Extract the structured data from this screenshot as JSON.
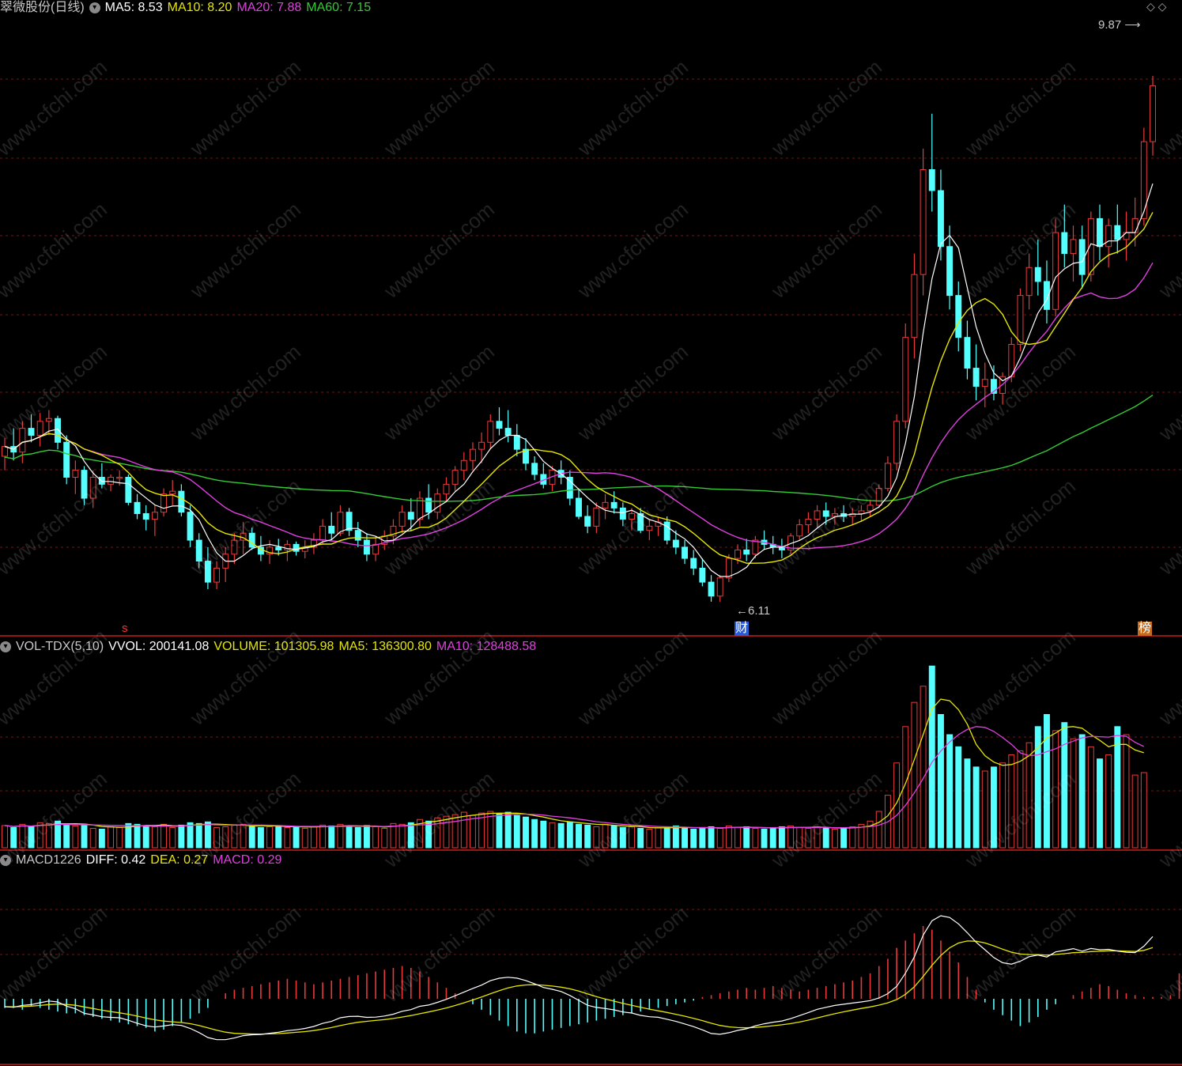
{
  "header_main": {
    "stock": "翠微股份(日线)",
    "ma5": "MA5: 8.53",
    "ma10": "MA10: 8.20",
    "ma20": "MA20: 7.88",
    "ma60": "MA60: 7.15"
  },
  "header_vol": {
    "name": "VOL-TDX(5,10)",
    "vvol": "VVOL: 200141.08",
    "volume": "VOLUME: 101305.98",
    "ma5": "MA5: 136300.80",
    "ma10": "MA10: 128488.58"
  },
  "header_macd": {
    "name": "MACD1226",
    "diff": "DIFF: 0.42",
    "dea": "DEA: 0.27",
    "macd": "MACD: 0.29"
  },
  "annotations": {
    "high": "9.87",
    "low": "6.11",
    "tag_s": "s",
    "tag_cai": "财",
    "tag_bang": "榜"
  },
  "watermark": "www.cfchi.com",
  "colors": {
    "up": "#e83a3a",
    "down": "#54ffff",
    "ma5": "#ffffff",
    "ma10": "#e6e600",
    "ma20": "#e040e0",
    "ma60": "#33cc33",
    "grid": "#7a1414",
    "divider": "#c81e1e"
  },
  "chart_data": {
    "type": "candlestick",
    "price_range": [
      5.9,
      10.3
    ],
    "ohlc": [
      [
        7.15,
        7.28,
        7.05,
        7.22
      ],
      [
        7.22,
        7.35,
        7.12,
        7.18
      ],
      [
        7.18,
        7.4,
        7.1,
        7.35
      ],
      [
        7.35,
        7.45,
        7.25,
        7.3
      ],
      [
        7.3,
        7.46,
        7.22,
        7.4
      ],
      [
        7.4,
        7.48,
        7.3,
        7.42
      ],
      [
        7.42,
        7.44,
        7.2,
        7.25
      ],
      [
        7.25,
        7.3,
        6.95,
        7.0
      ],
      [
        7.0,
        7.12,
        6.88,
        7.05
      ],
      [
        7.05,
        7.08,
        6.8,
        6.85
      ],
      [
        6.85,
        7.05,
        6.78,
        7.0
      ],
      [
        7.0,
        7.1,
        6.92,
        6.95
      ],
      [
        6.95,
        7.02,
        6.9,
        7.0
      ],
      [
        7.0,
        7.05,
        6.94,
        7.0
      ],
      [
        7.0,
        7.02,
        6.8,
        6.82
      ],
      [
        6.82,
        6.88,
        6.7,
        6.74
      ],
      [
        6.74,
        6.8,
        6.62,
        6.7
      ],
      [
        6.7,
        6.8,
        6.58,
        6.75
      ],
      [
        6.75,
        6.92,
        6.72,
        6.88
      ],
      [
        6.88,
        6.98,
        6.8,
        6.9
      ],
      [
        6.9,
        6.95,
        6.72,
        6.75
      ],
      [
        6.75,
        6.8,
        6.5,
        6.55
      ],
      [
        6.55,
        6.6,
        6.35,
        6.4
      ],
      [
        6.4,
        6.5,
        6.2,
        6.25
      ],
      [
        6.25,
        6.4,
        6.2,
        6.35
      ],
      [
        6.35,
        6.5,
        6.25,
        6.45
      ],
      [
        6.45,
        6.6,
        6.38,
        6.55
      ],
      [
        6.55,
        6.68,
        6.45,
        6.6
      ],
      [
        6.6,
        6.64,
        6.48,
        6.5
      ],
      [
        6.5,
        6.58,
        6.4,
        6.45
      ],
      [
        6.45,
        6.55,
        6.38,
        6.5
      ],
      [
        6.5,
        6.56,
        6.44,
        6.48
      ],
      [
        6.48,
        6.55,
        6.4,
        6.52
      ],
      [
        6.52,
        6.54,
        6.44,
        6.47
      ],
      [
        6.47,
        6.55,
        6.42,
        6.5
      ],
      [
        6.5,
        6.6,
        6.45,
        6.55
      ],
      [
        6.55,
        6.7,
        6.52,
        6.65
      ],
      [
        6.65,
        6.75,
        6.55,
        6.6
      ],
      [
        6.6,
        6.8,
        6.58,
        6.75
      ],
      [
        6.75,
        6.78,
        6.58,
        6.62
      ],
      [
        6.62,
        6.68,
        6.5,
        6.55
      ],
      [
        6.55,
        6.6,
        6.4,
        6.45
      ],
      [
        6.45,
        6.58,
        6.4,
        6.52
      ],
      [
        6.52,
        6.62,
        6.48,
        6.58
      ],
      [
        6.58,
        6.7,
        6.52,
        6.65
      ],
      [
        6.65,
        6.8,
        6.6,
        6.75
      ],
      [
        6.75,
        6.85,
        6.62,
        6.7
      ],
      [
        6.7,
        6.9,
        6.65,
        6.85
      ],
      [
        6.85,
        6.95,
        6.7,
        6.75
      ],
      [
        6.75,
        6.92,
        6.7,
        6.88
      ],
      [
        6.88,
        7.0,
        6.82,
        6.95
      ],
      [
        6.95,
        7.08,
        6.9,
        7.05
      ],
      [
        7.05,
        7.18,
        6.98,
        7.12
      ],
      [
        7.12,
        7.25,
        7.05,
        7.2
      ],
      [
        7.2,
        7.32,
        7.1,
        7.25
      ],
      [
        7.25,
        7.45,
        7.2,
        7.4
      ],
      [
        7.4,
        7.5,
        7.3,
        7.35
      ],
      [
        7.35,
        7.48,
        7.25,
        7.3
      ],
      [
        7.3,
        7.38,
        7.15,
        7.2
      ],
      [
        7.2,
        7.28,
        7.05,
        7.1
      ],
      [
        7.1,
        7.15,
        6.98,
        7.02
      ],
      [
        7.02,
        7.1,
        6.92,
        6.95
      ],
      [
        6.95,
        7.08,
        6.9,
        7.05
      ],
      [
        7.05,
        7.12,
        6.95,
        7.0
      ],
      [
        7.0,
        7.05,
        6.8,
        6.85
      ],
      [
        6.85,
        6.92,
        6.7,
        6.72
      ],
      [
        6.72,
        6.8,
        6.6,
        6.65
      ],
      [
        6.65,
        6.82,
        6.6,
        6.78
      ],
      [
        6.78,
        6.88,
        6.7,
        6.82
      ],
      [
        6.82,
        6.9,
        6.74,
        6.78
      ],
      [
        6.78,
        6.82,
        6.65,
        6.7
      ],
      [
        6.7,
        6.78,
        6.62,
        6.74
      ],
      [
        6.74,
        6.78,
        6.6,
        6.62
      ],
      [
        6.62,
        6.7,
        6.55,
        6.65
      ],
      [
        6.65,
        6.72,
        6.58,
        6.68
      ],
      [
        6.68,
        6.72,
        6.52,
        6.55
      ],
      [
        6.55,
        6.62,
        6.45,
        6.5
      ],
      [
        6.5,
        6.55,
        6.38,
        6.42
      ],
      [
        6.42,
        6.48,
        6.3,
        6.35
      ],
      [
        6.35,
        6.42,
        6.22,
        6.25
      ],
      [
        6.25,
        6.3,
        6.11,
        6.15
      ],
      [
        6.15,
        6.3,
        6.11,
        6.28
      ],
      [
        6.28,
        6.45,
        6.25,
        6.42
      ],
      [
        6.42,
        6.52,
        6.38,
        6.48
      ],
      [
        6.48,
        6.56,
        6.4,
        6.45
      ],
      [
        6.45,
        6.58,
        6.42,
        6.55
      ],
      [
        6.55,
        6.62,
        6.48,
        6.52
      ],
      [
        6.52,
        6.58,
        6.45,
        6.5
      ],
      [
        6.5,
        6.56,
        6.42,
        6.48
      ],
      [
        6.48,
        6.6,
        6.45,
        6.58
      ],
      [
        6.58,
        6.7,
        6.55,
        6.66
      ],
      [
        6.66,
        6.75,
        6.6,
        6.7
      ],
      [
        6.7,
        6.8,
        6.64,
        6.76
      ],
      [
        6.76,
        6.82,
        6.66,
        6.72
      ],
      [
        6.72,
        6.78,
        6.66,
        6.74
      ],
      [
        6.74,
        6.8,
        6.68,
        6.72
      ],
      [
        6.72,
        6.78,
        6.66,
        6.74
      ],
      [
        6.74,
        6.8,
        6.68,
        6.76
      ],
      [
        6.76,
        6.84,
        6.72,
        6.8
      ],
      [
        6.8,
        6.95,
        6.78,
        6.92
      ],
      [
        6.92,
        7.15,
        6.9,
        7.1
      ],
      [
        7.1,
        7.45,
        7.05,
        7.4
      ],
      [
        7.4,
        8.1,
        7.35,
        8.0
      ],
      [
        8.0,
        8.6,
        7.85,
        8.45
      ],
      [
        8.45,
        9.35,
        8.3,
        9.2
      ],
      [
        9.2,
        9.6,
        8.9,
        9.05
      ],
      [
        9.05,
        9.2,
        8.55,
        8.65
      ],
      [
        8.65,
        8.8,
        8.2,
        8.3
      ],
      [
        8.3,
        8.4,
        7.9,
        8.0
      ],
      [
        8.0,
        8.12,
        7.7,
        7.78
      ],
      [
        7.78,
        7.95,
        7.55,
        7.65
      ],
      [
        7.65,
        7.82,
        7.5,
        7.7
      ],
      [
        7.7,
        7.8,
        7.55,
        7.6
      ],
      [
        7.6,
        7.75,
        7.52,
        7.72
      ],
      [
        7.72,
        8.0,
        7.68,
        7.95
      ],
      [
        7.95,
        8.35,
        7.9,
        8.3
      ],
      [
        8.3,
        8.6,
        8.2,
        8.5
      ],
      [
        8.5,
        8.7,
        8.3,
        8.4
      ],
      [
        8.4,
        8.55,
        8.1,
        8.2
      ],
      [
        8.2,
        8.85,
        8.15,
        8.75
      ],
      [
        8.75,
        8.95,
        8.5,
        8.6
      ],
      [
        8.6,
        8.8,
        8.4,
        8.7
      ],
      [
        8.7,
        8.8,
        8.35,
        8.45
      ],
      [
        8.45,
        8.9,
        8.4,
        8.85
      ],
      [
        8.85,
        8.95,
        8.55,
        8.65
      ],
      [
        8.65,
        8.85,
        8.5,
        8.8
      ],
      [
        8.8,
        8.95,
        8.6,
        8.7
      ],
      [
        8.7,
        8.9,
        8.55,
        8.75
      ],
      [
        8.75,
        9.0,
        8.65,
        8.85
      ],
      [
        8.85,
        9.5,
        8.8,
        9.4
      ],
      [
        9.4,
        9.87,
        9.3,
        9.8
      ]
    ],
    "volume": [
      55,
      50,
      58,
      52,
      62,
      60,
      66,
      56,
      54,
      58,
      48,
      46,
      52,
      50,
      60,
      58,
      55,
      52,
      58,
      50,
      56,
      62,
      60,
      64,
      50,
      52,
      56,
      58,
      54,
      50,
      52,
      55,
      50,
      53,
      48,
      52,
      56,
      54,
      58,
      52,
      50,
      55,
      52,
      48,
      60,
      58,
      62,
      70,
      66,
      74,
      78,
      82,
      88,
      80,
      86,
      90,
      84,
      88,
      80,
      76,
      70,
      66,
      62,
      60,
      64,
      58,
      56,
      52,
      58,
      54,
      50,
      52,
      48,
      46,
      50,
      52,
      54,
      48,
      46,
      50,
      52,
      48,
      54,
      50,
      52,
      48,
      46,
      50,
      52,
      54,
      50,
      48,
      52,
      50,
      46,
      48,
      52,
      58,
      66,
      90,
      130,
      210,
      300,
      360,
      400,
      450,
      330,
      280,
      250,
      220,
      200,
      190,
      200,
      210,
      230,
      240,
      260,
      300,
      330,
      290,
      310,
      270,
      280,
      250,
      220,
      230,
      300,
      280,
      180,
      186
    ],
    "macd_hist": [
      -0.05,
      -0.05,
      -0.06,
      -0.04,
      -0.05,
      -0.06,
      -0.07,
      -0.08,
      -0.08,
      -0.09,
      -0.1,
      -0.11,
      -0.12,
      -0.13,
      -0.14,
      -0.15,
      -0.16,
      -0.18,
      -0.17,
      -0.15,
      -0.13,
      -0.11,
      -0.08,
      -0.05,
      0.0,
      0.03,
      0.05,
      0.06,
      0.07,
      0.08,
      0.09,
      0.1,
      0.11,
      0.1,
      0.09,
      0.08,
      0.09,
      0.1,
      0.11,
      0.12,
      0.13,
      0.14,
      0.15,
      0.16,
      0.17,
      0.18,
      0.17,
      0.15,
      0.12,
      0.09,
      0.06,
      0.03,
      0.0,
      -0.03,
      -0.06,
      -0.09,
      -0.12,
      -0.15,
      -0.18,
      -0.19,
      -0.19,
      -0.18,
      -0.17,
      -0.16,
      -0.15,
      -0.14,
      -0.13,
      -0.12,
      -0.11,
      -0.1,
      -0.09,
      -0.08,
      -0.07,
      -0.06,
      -0.05,
      -0.04,
      -0.03,
      -0.02,
      -0.01,
      0.01,
      0.02,
      0.03,
      0.04,
      0.05,
      0.06,
      0.05,
      0.06,
      0.07,
      0.06,
      0.05,
      0.04,
      0.05,
      0.06,
      0.07,
      0.08,
      0.09,
      0.1,
      0.12,
      0.14,
      0.18,
      0.22,
      0.28,
      0.32,
      0.36,
      0.4,
      0.38,
      0.32,
      0.26,
      0.2,
      0.12,
      0.05,
      -0.02,
      -0.06,
      -0.09,
      -0.12,
      -0.15,
      -0.13,
      -0.1,
      -0.06,
      -0.03,
      0.0,
      0.02,
      0.04,
      0.06,
      0.08,
      0.07,
      0.05,
      0.03,
      0.02,
      0.01,
      0.01,
      0.01,
      0.02,
      0.14,
      0.29
    ],
    "annotations": [
      "9.87",
      "6.11"
    ]
  }
}
